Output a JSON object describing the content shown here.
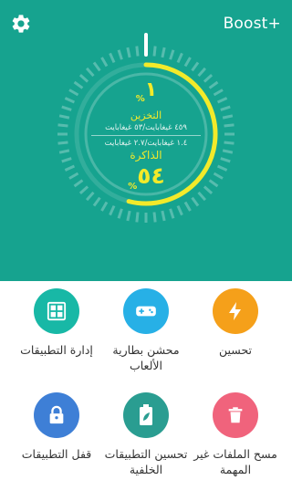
{
  "header": {
    "title": "Boost+",
    "settings_icon": "gear-icon"
  },
  "gauge": {
    "storage": {
      "percent": "١",
      "pct_sign": "%",
      "label": "التخزين",
      "detail": "٤٥٩ غيغابايت/٥٣ غيغابايت",
      "fraction": 0.01
    },
    "memory": {
      "percent": "٥٤",
      "pct_sign": "%",
      "label": "الذاكرة",
      "detail": "١.٤ غيغابايت/٢.٧ غيغابايت",
      "fraction": 0.54
    }
  },
  "tools": [
    {
      "label": "تحسين",
      "icon": "lightning-icon",
      "color": "#f5a01a"
    },
    {
      "label": "محشن بطارية الألعاب",
      "icon": "gamepad-icon",
      "color": "#27b0e6"
    },
    {
      "label": "إدارة التطبيقات",
      "icon": "app-grid-icon",
      "color": "#18b8a6"
    },
    {
      "label": "مسح الملفات غير المهمة",
      "icon": "trash-icon",
      "color": "#f0637c"
    },
    {
      "label": "تحسين التطبيقات الخلفية",
      "icon": "battery-leaf-icon",
      "color": "#2a9d91"
    },
    {
      "label": "قفل التطبيقات",
      "icon": "lock-icon",
      "color": "#3e7fd6"
    }
  ],
  "colors": {
    "header_bg": "#16a38f",
    "gauge_accent": "#f2ea2a"
  }
}
